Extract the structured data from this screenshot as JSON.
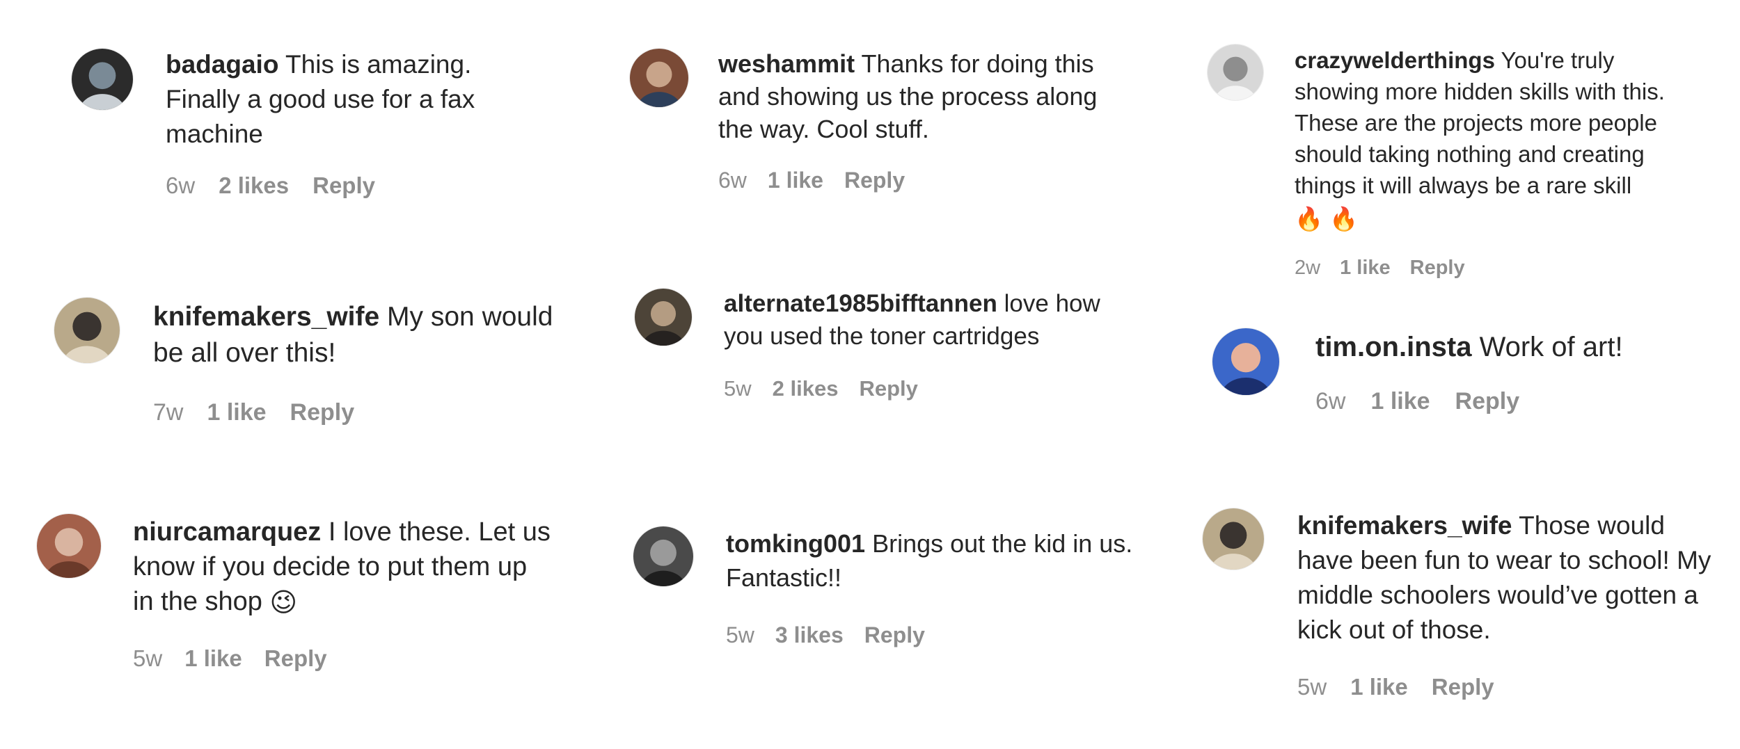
{
  "comments": [
    {
      "username": "badagaio",
      "text": "This is amazing. Finally a good use for a fax machine",
      "emoji": "",
      "time": "6w",
      "likes": "2 likes",
      "reply": "Reply",
      "avatar_icon": "user-avatar-icon",
      "avatar_colors": [
        "#2b2b2b",
        "#7a8a96",
        "#c9cfd4"
      ]
    },
    {
      "username": "knifemakers_wife",
      "text": "My son would be all over this!",
      "emoji": "",
      "time": "7w",
      "likes": "1 like",
      "reply": "Reply",
      "avatar_icon": "user-avatar-icon",
      "avatar_colors": [
        "#b9a98a",
        "#3a3430",
        "#e2d7c3"
      ]
    },
    {
      "username": "niurcamarquez",
      "text": "I love these. Let us know if you decide to put them up in the shop",
      "emoji": "😉",
      "time": "5w",
      "likes": "1 like",
      "reply": "Reply",
      "avatar_icon": "user-avatar-icon",
      "avatar_colors": [
        "#a3604a",
        "#d9b4a0",
        "#6b3a2a"
      ]
    },
    {
      "username": "weshammit",
      "text": "Thanks for doing this and showing us the process along the way. Cool stuff.",
      "emoji": "",
      "time": "6w",
      "likes": "1 like",
      "reply": "Reply",
      "avatar_icon": "user-avatar-icon",
      "avatar_colors": [
        "#7a4a36",
        "#c8a48a",
        "#2d3f5a"
      ]
    },
    {
      "username": "alternate1985bifftannen",
      "text": "love how you used the toner cartridges",
      "emoji": "",
      "time": "5w",
      "likes": "2 likes",
      "reply": "Reply",
      "avatar_icon": "user-avatar-icon",
      "avatar_colors": [
        "#4d4438",
        "#b49c82",
        "#262220"
      ]
    },
    {
      "username": "tomking001",
      "text": "Brings out the kid in us. Fantastic!!",
      "emoji": "",
      "time": "5w",
      "likes": "3 likes",
      "reply": "Reply",
      "avatar_icon": "user-avatar-icon",
      "avatar_colors": [
        "#4a4a4a",
        "#9a9a9a",
        "#1e1e1e"
      ]
    },
    {
      "username": "crazywelderthings",
      "text": "You're truly showing more hidden skills with this. These are the projects more people should taking nothing and creating things it will always be a rare skill",
      "emoji": "🔥 🔥",
      "time": "2w",
      "likes": "1 like",
      "reply": "Reply",
      "avatar_icon": "user-avatar-icon",
      "avatar_colors": [
        "#d8d8d8",
        "#8e8e8e",
        "#f4f4f4"
      ]
    },
    {
      "username": "tim.on.insta",
      "text": "Work of art!",
      "emoji": "",
      "time": "6w",
      "likes": "1 like",
      "reply": "Reply",
      "avatar_icon": "user-avatar-icon",
      "avatar_colors": [
        "#3b67c9",
        "#e7b19a",
        "#1b2f6e"
      ]
    },
    {
      "username": "knifemakers_wife",
      "text": "Those would have been fun to wear to school! My middle schoolers would’ve gotten a kick out of those.",
      "emoji": "",
      "time": "5w",
      "likes": "1 like",
      "reply": "Reply",
      "avatar_icon": "user-avatar-icon",
      "avatar_colors": [
        "#b9a98a",
        "#3a3430",
        "#e2d7c3"
      ]
    }
  ],
  "colors": {
    "text": "#262626",
    "meta": "#8e8e8e",
    "background": "#ffffff"
  }
}
